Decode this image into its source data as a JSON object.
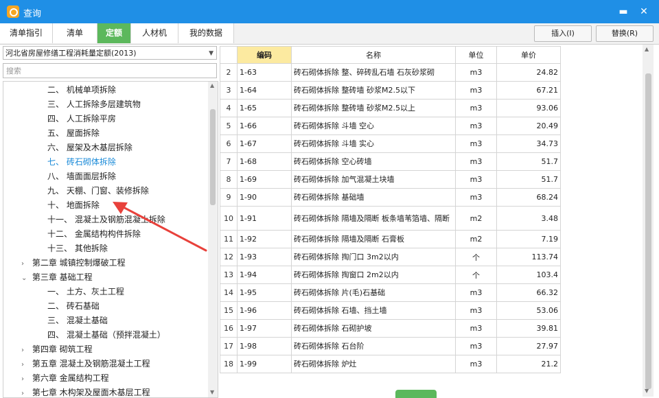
{
  "window": {
    "title": "查询",
    "minimize": "▬",
    "close": "✕"
  },
  "tabs": [
    {
      "label": "清单指引"
    },
    {
      "label": "清单"
    },
    {
      "label": "定额"
    },
    {
      "label": "人材机"
    },
    {
      "label": "我的数据"
    }
  ],
  "actions": {
    "insert": "插入(I)",
    "replace": "替换(R)"
  },
  "left_panel": {
    "quota_library": "河北省房屋修缮工程消耗量定额(2013)",
    "search_placeholder": "搜索",
    "tree": [
      {
        "label": "二、 机械单项拆除"
      },
      {
        "label": "三、 人工拆除多层建筑物"
      },
      {
        "label": "四、 人工拆除平房"
      },
      {
        "label": "五、 屋面拆除"
      },
      {
        "label": "六、 屋架及木基层拆除"
      },
      {
        "label": "七、 砖石砌体拆除"
      },
      {
        "label": "八、 墙面面层拆除"
      },
      {
        "label": "九、 天棚、门窗、装修拆除"
      },
      {
        "label": "十、 地面拆除"
      },
      {
        "label": "十一、 混凝土及钢筋混凝土拆除"
      },
      {
        "label": "十二、 金属结构构件拆除"
      },
      {
        "label": "十三、 其他拆除"
      },
      {
        "label": "第二章 城镇控制爆破工程"
      },
      {
        "label": "第三章 基础工程"
      },
      {
        "label": "一、 土方、灰土工程"
      },
      {
        "label": "二、 砖石基础"
      },
      {
        "label": "三、 混凝土基础"
      },
      {
        "label": "四、 混凝土基础（预拌混凝土）"
      },
      {
        "label": "第四章 砌筑工程"
      },
      {
        "label": "第五章 混凝土及钢筋混凝土工程"
      },
      {
        "label": "第六章 金属结构工程"
      },
      {
        "label": "第七章 木构架及屋面木基层工程"
      }
    ]
  },
  "table": {
    "headers": {
      "code": "编码",
      "name": "名称",
      "unit": "单位",
      "price": "单价"
    },
    "rows": [
      {
        "no": "2",
        "code": "1-63",
        "name": "砖石砌体拆除 整、碎砖乱石墙 石灰砂浆砌",
        "unit": "m3",
        "price": "24.82"
      },
      {
        "no": "3",
        "code": "1-64",
        "name": "砖石砌体拆除 整砖墙 砂浆M2.5以下",
        "unit": "m3",
        "price": "67.21"
      },
      {
        "no": "4",
        "code": "1-65",
        "name": "砖石砌体拆除 整砖墙 砂浆M2.5以上",
        "unit": "m3",
        "price": "93.06"
      },
      {
        "no": "5",
        "code": "1-66",
        "name": "砖石砌体拆除 斗墙 空心",
        "unit": "m3",
        "price": "20.49"
      },
      {
        "no": "6",
        "code": "1-67",
        "name": "砖石砌体拆除 斗墙 实心",
        "unit": "m3",
        "price": "34.73"
      },
      {
        "no": "7",
        "code": "1-68",
        "name": "砖石砌体拆除 空心砖墙",
        "unit": "m3",
        "price": "51.7"
      },
      {
        "no": "8",
        "code": "1-69",
        "name": "砖石砌体拆除 加气混凝土块墙",
        "unit": "m3",
        "price": "51.7"
      },
      {
        "no": "9",
        "code": "1-90",
        "name": "砖石砌体拆除 基础墙",
        "unit": "m3",
        "price": "68.24"
      },
      {
        "no": "10",
        "code": "1-91",
        "name": "砖石砌体拆除 隔墙及隔断 板条墙苇箔墙、隔断",
        "unit": "m2",
        "price": "3.48"
      },
      {
        "no": "11",
        "code": "1-92",
        "name": "砖石砌体拆除 隔墙及隔断 石膏板",
        "unit": "m2",
        "price": "7.19"
      },
      {
        "no": "12",
        "code": "1-93",
        "name": "砖石砌体拆除 掏门口 3m2以内",
        "unit": "个",
        "price": "113.74"
      },
      {
        "no": "13",
        "code": "1-94",
        "name": "砖石砌体拆除 掏窗口 2m2以内",
        "unit": "个",
        "price": "103.4"
      },
      {
        "no": "14",
        "code": "1-95",
        "name": "砖石砌体拆除 片(毛)石基础",
        "unit": "m3",
        "price": "66.32"
      },
      {
        "no": "15",
        "code": "1-96",
        "name": "砖石砌体拆除 石墙、挡土墙",
        "unit": "m3",
        "price": "53.06"
      },
      {
        "no": "16",
        "code": "1-97",
        "name": "砖石砌体拆除 石砌护坡",
        "unit": "m3",
        "price": "39.81"
      },
      {
        "no": "17",
        "code": "1-98",
        "name": "砖石砌体拆除 石台阶",
        "unit": "m3",
        "price": "27.97"
      },
      {
        "no": "18",
        "code": "1-99",
        "name": "砖石砌体拆除 炉灶",
        "unit": "m3",
        "price": "21.2"
      }
    ]
  },
  "colors": {
    "title_bar": "#1f8fe6",
    "active_tab": "#5cb85c",
    "code_header": "#fceaa0",
    "selected_node": "#1a8ad8",
    "annotation_arrow": "#e8413b"
  }
}
